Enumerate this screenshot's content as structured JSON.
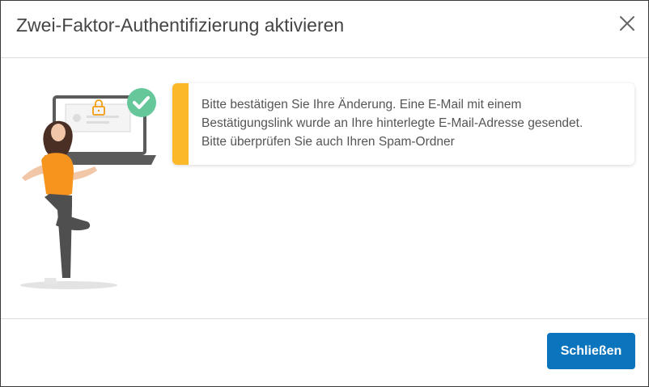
{
  "dialog": {
    "title": "Zwei-Faktor-Authentifizierung aktivieren",
    "close_icon": "close-icon"
  },
  "illustration": {
    "icons": [
      "laptop-icon",
      "lock-icon",
      "check-circle-icon"
    ],
    "accent_color": "#66c89a",
    "lock_color": "#f39c12",
    "shirt_color": "#f7941d"
  },
  "alert": {
    "variant": "warning",
    "accent_color": "#fbb829",
    "lines": [
      "Bitte bestätigen Sie Ihre Änderung. Eine E-Mail mit einem",
      "Bestätigungslink wurde an Ihre hinterlegte E-Mail-Adresse gesendet.",
      "Bitte überprüfen Sie auch Ihren Spam-Ordner"
    ]
  },
  "footer": {
    "close_label": "Schließen",
    "button_color": "#0a75bc"
  }
}
